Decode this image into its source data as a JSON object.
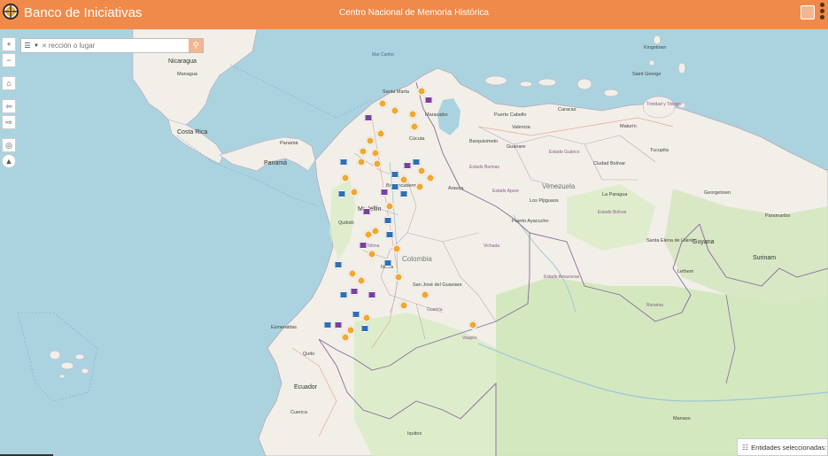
{
  "header": {
    "title": "Banco de Iniciativas",
    "center": "Centro Nacional de Memoria Histórica"
  },
  "search": {
    "placeholder": "rección o lugar"
  },
  "footer": {
    "entidades": "Entidades seleccionadas:"
  },
  "colors": {
    "header": "#ef8a4a",
    "water": "#aad3df",
    "land": "#f2efe9",
    "forest": "#cfe6b8",
    "marker_orange": "#f0a830",
    "marker_purple": "#7b3fa0",
    "marker_blue": "#2f6fb5"
  },
  "icons": [
    "home-icon",
    "back-arrow-icon",
    "forward-arrow-icon",
    "locate-icon",
    "compass-icon",
    "search-icon",
    "clear-icon"
  ],
  "map": {
    "labels": {
      "nicaragua": "Nicaragua",
      "managua": "Managua",
      "costa_rica": "Costa Rica",
      "panama_country": "Panamá",
      "panama_city": "Panamá",
      "kingstown": "Kingstown",
      "saint_george": "Saint George",
      "santa_marta": "Santa Marta",
      "caracas": "Caracas",
      "trinidad": "Trinidad y Tobago",
      "maturin": "Maturín",
      "barquisimeto": "Barquisimeto",
      "ciudad_bolivar": "Ciudad Bolívar",
      "venezuela": "Venezuela",
      "georgetown": "Georgetown",
      "los_pijiguaos": "Los Pijiguaos",
      "puerto_ayacucho": "Puerto Ayacucho",
      "paramaribo": "Paramaribo",
      "guyana": "Guyana",
      "surinam": "Surinam",
      "medellin": "Medellín",
      "quibdo": "Quibdó",
      "colombia": "Colombia",
      "san_jose": "San José del Guaviare",
      "vichada": "Vichada",
      "amazonas_state": "Estado Amazonas",
      "guainia": "Guainía",
      "vaupes": "Vaupés",
      "esmeraldas": "Esmeraldas",
      "quito": "Quito",
      "ecuador": "Ecuador",
      "cuenca": "Cuenca",
      "iquitos": "Iquitos",
      "manaus": "Manaos",
      "lethem": "Lethem",
      "roraima": "Roraima",
      "santa_elena": "Santa Elena de Uairén",
      "apure": "Estado Apure",
      "bolivar": "Estado Bolívar",
      "guarico": "Estado Guárico",
      "puerto_cabello": "Puerto Cabello",
      "maracaibo": "Maracaibo",
      "tolima": "Tolima",
      "neiva": "Neiva",
      "cucuta": "Cúcuta",
      "arauca": "Arauca",
      "valencia": "Valencia",
      "guanare": "Guanare",
      "barinas": "Estado Barinas",
      "tucupita": "Tucupita",
      "barrancabermeja": "Barrancabermeja",
      "la_paragua": "La Paragua",
      "mar_caribe": "Mar Caribe"
    }
  }
}
